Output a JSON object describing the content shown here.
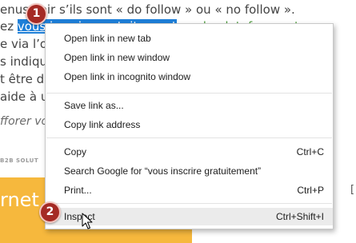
{
  "article": {
    "line1_pre": "enus ",
    "line1_post": "voir s’ils sont « do follow » ou « no follow ».",
    "line2_pre": "ez ",
    "line2_selected": "vous inscrire gratuitement",
    "line2_post": " sur la plateforme et",
    "line3": "e via l’on",
    "line4": "s indique",
    "line5": "t être di",
    "line6": "aide à un",
    "line7": "fforer votr",
    "logos": [
      "B2B SOLUT"
    ],
    "banner_text": "rnet I",
    "right_fragment": "["
  },
  "context_menu": {
    "items": [
      {
        "label": "Open link in new tab",
        "shortcut": ""
      },
      {
        "label": "Open link in new window",
        "shortcut": ""
      },
      {
        "label": "Open link in incognito window",
        "shortcut": ""
      },
      {
        "label": "Save link as...",
        "shortcut": ""
      },
      {
        "label": "Copy link address",
        "shortcut": ""
      },
      {
        "label": "Copy",
        "shortcut": "Ctrl+C"
      },
      {
        "label": "Search Google for “vous inscrire gratuitement”",
        "shortcut": ""
      },
      {
        "label": "Print...",
        "shortcut": "Ctrl+P"
      },
      {
        "label": "Inspect",
        "shortcut": "Ctrl+Shift+I"
      }
    ],
    "hovered_item": "Inspect"
  },
  "badges": {
    "step1": "1",
    "step2": "2"
  },
  "colors": {
    "selection": "#1e7fd8",
    "badge": "#a52a24",
    "banner": "#f6b83d",
    "hover": "#ebebeb"
  },
  "icons": {
    "cursor": "arrow-cursor-icon"
  }
}
